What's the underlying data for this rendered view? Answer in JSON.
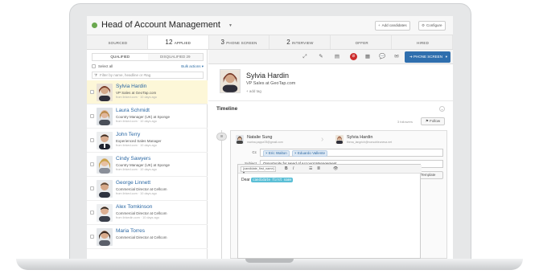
{
  "header": {
    "job_title": "Head of Account Management",
    "add_candidates_label": "Add candidates",
    "configure_label": "Configure"
  },
  "stages": [
    {
      "num": "",
      "label": "SOURCED"
    },
    {
      "num": "12",
      "label": "APPLIED"
    },
    {
      "num": "3",
      "label": "PHONE SCREEN"
    },
    {
      "num": "2",
      "label": "INTERVIEW"
    },
    {
      "num": "",
      "label": "OFFER"
    },
    {
      "num": "",
      "label": "HIRED"
    }
  ],
  "left": {
    "tab_qualified": "QUALIFIED",
    "tab_disqualified": "DISQUALIFIED",
    "disqualified_count": "29",
    "select_all": "Select all",
    "bulk_actions": "Bulk actions ▾",
    "filter_placeholder": "Filter by name, headline or #tag"
  },
  "candidates": [
    {
      "name": "Sylvia Hardin",
      "role": "VP Sales at GeoTap.com",
      "meta": "from linked.com · 10 days ago",
      "selected": true
    },
    {
      "name": "Laura Schmidt",
      "role": "Country Manager (UK) at Sponge",
      "meta": "from linked.com · 10 days ago",
      "selected": false
    },
    {
      "name": "John Terry",
      "role": "Experienced Sales Manager",
      "meta": "from linked.com · 10 days ago",
      "selected": false
    },
    {
      "name": "Cindy Sawyers",
      "role": "Country Manager (UK) at Sponge",
      "meta": "from linked.com · 10 days ago",
      "selected": false
    },
    {
      "name": "George Linnett",
      "role": "Commercial Director at Cellcom",
      "meta": "from linked.com · 10 days ago",
      "selected": false
    },
    {
      "name": "Alex Tomkinson",
      "role": "Commercial Director at Cellcom",
      "meta": "from linkedin.com · 10 days ago",
      "selected": false
    },
    {
      "name": "Maria Torres",
      "role": "Commercial Director at Cellcom",
      "meta": "",
      "selected": false
    }
  ],
  "toolbar": {
    "phone_screen_label": "PHONE SCREEN"
  },
  "profile": {
    "name": "Sylvia Hardin",
    "role": "VP Sales at GeoTap.com",
    "add_tag": "+ add tag"
  },
  "timeline": {
    "title": "Timeline",
    "followers": "3 followers",
    "follow_label": "Follow"
  },
  "email": {
    "from_name": "Natalie Sung",
    "from_mail": "marina.pappa78@gmail.com",
    "to_name": "Sylvia Hardin",
    "to_mail": "thena_langrich@nonsobleuneva.net",
    "cc_label": "Cc",
    "cc_chips": [
      "× Eric Walton",
      "× Eduardo Vallente"
    ],
    "subject_label": "Subject",
    "subject_value": "Opportunity for Head of Account Management",
    "template_label": "Template",
    "template_value": "Choose a template",
    "save_template_label": "Save Template",
    "editor_var": "{candidate_first_name}",
    "body_prefix": "Dear",
    "body_var": "candidate first name"
  },
  "colors": {
    "accent": "#2f6fae",
    "selected_row": "#fdf7d8",
    "status_green": "#6aa84f",
    "link_blue": "#2a67a3"
  }
}
